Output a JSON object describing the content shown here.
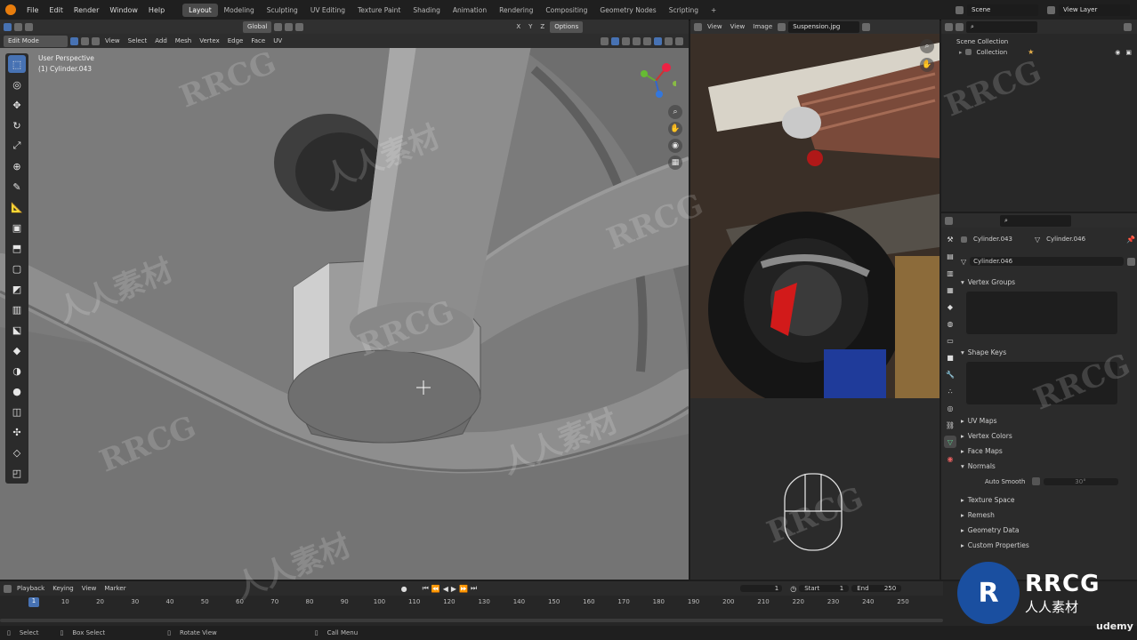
{
  "menu": {
    "items": [
      "File",
      "Edit",
      "Render",
      "Window",
      "Help"
    ],
    "workspaces": [
      "Layout",
      "Modeling",
      "Sculpting",
      "UV Editing",
      "Texture Paint",
      "Shading",
      "Animation",
      "Rendering",
      "Compositing",
      "Geometry Nodes",
      "Scripting"
    ],
    "active_workspace": "Layout",
    "add_tab": "+",
    "scene": "Scene",
    "view_layer": "View Layer"
  },
  "viewport": {
    "mode": "Edit Mode",
    "header_menus": [
      "View",
      "Select",
      "Add",
      "Mesh",
      "Vertex",
      "Edge",
      "Face",
      "UV"
    ],
    "transform_orientation": "Global",
    "options": "Options",
    "axes": [
      "X",
      "Y",
      "Z"
    ],
    "perspective_label": "User Perspective",
    "object_label": "(1) Cylinder.043"
  },
  "image_editor": {
    "menus": [
      "View",
      "View",
      "Image"
    ],
    "image_name": "Suspension.jpg"
  },
  "outliner": {
    "scene_collection": "Scene Collection",
    "collection": "Collection"
  },
  "properties": {
    "object_name": "Cylinder.043",
    "mesh_name": "Cylinder.046",
    "data_field": "Cylinder.046",
    "panels": {
      "vertex_groups": "Vertex Groups",
      "shape_keys": "Shape Keys",
      "uv_maps": "UV Maps",
      "vertex_colors": "Vertex Colors",
      "face_maps": "Face Maps",
      "normals": "Normals",
      "auto_smooth": "Auto Smooth",
      "auto_smooth_angle": "30°",
      "texture_space": "Texture Space",
      "remesh": "Remesh",
      "geometry_data": "Geometry Data",
      "custom_properties": "Custom Properties"
    }
  },
  "timeline": {
    "menus": [
      "Playback",
      "Keying",
      "View",
      "Marker"
    ],
    "current_frame": "1",
    "start_label": "Start",
    "start": "1",
    "end_label": "End",
    "end": "250",
    "ticks": [
      "1",
      "10",
      "20",
      "30",
      "40",
      "50",
      "60",
      "70",
      "80",
      "90",
      "100",
      "110",
      "120",
      "130",
      "140",
      "150",
      "160",
      "170",
      "180",
      "190",
      "200",
      "210",
      "220",
      "230",
      "240",
      "250"
    ],
    "playhead_frame": 1
  },
  "statusbar": {
    "select": "Select",
    "box_select": "Box Select",
    "rotate_view": "Rotate View",
    "call_menu": "Call Menu"
  },
  "watermark": {
    "rrcg": "RRCG",
    "chinese": "人人素材",
    "udemy": "udemy"
  },
  "colors": {
    "accent": "#4772b3",
    "header": "#303030",
    "viewport_bg": "#7a7a7a",
    "blender_orange": "#e87d0d"
  }
}
